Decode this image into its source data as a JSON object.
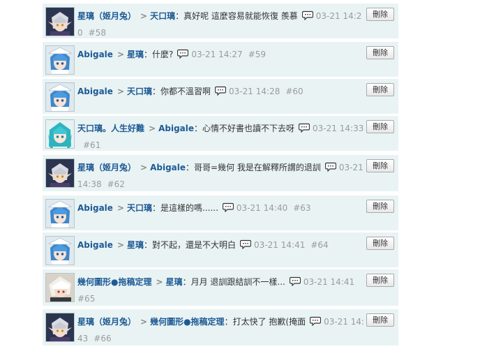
{
  "comments": [
    {
      "author": "星璃（姬月兔）",
      "target": "天口璃",
      "separator": "：",
      "text": "真好呢 這麼容易就能恢復 羨慕",
      "date": "03-21",
      "time": "14:20",
      "floor": "#58",
      "delete_label": "刪除",
      "avatar": "elf-avatar"
    },
    {
      "author": "Abigale",
      "target": "星璃",
      "separator": "：",
      "text": "什麼?",
      "date": "03-21",
      "time": "14:27",
      "floor": "#59",
      "delete_label": "刪除",
      "avatar": "blue-hair-avatar"
    },
    {
      "author": "Abigale",
      "target": "天口璃",
      "separator": "：",
      "text": "你都不溫習啊",
      "date": "03-21",
      "time": "14:28",
      "floor": "#60",
      "delete_label": "刪除",
      "avatar": "blue-hair-avatar"
    },
    {
      "author": "天口璃。人生好難",
      "target": "Abigale",
      "separator": "：",
      "text": "心情不好書也讀不下去呀",
      "date": "03-21",
      "time": "14:33",
      "floor": "#61",
      "delete_label": "刪除",
      "avatar": "teal-hair-avatar"
    },
    {
      "author": "星璃（姬月兔）",
      "target": "Abigale",
      "separator": "：",
      "text": "哥哥=幾何 我是在解釋所謂的退訓",
      "date": "03-",
      "time": "21 14:38",
      "floor": "#62",
      "delete_label": "刪除",
      "avatar": "elf-avatar"
    },
    {
      "author": "Abigale",
      "target": "天口璃",
      "separator": "：",
      "text": "是這樣的嗎......",
      "date": "03-21",
      "time": "14:40",
      "floor": "#63",
      "delete_label": "刪除",
      "avatar": "blue-hair-avatar"
    },
    {
      "author": "Abigale",
      "target": "星璃",
      "separator": "：",
      "text": "對不起，還是不大明白",
      "date": "03-21",
      "time": "14:41",
      "floor": "#64",
      "delete_label": "刪除",
      "avatar": "blue-hair-avatar"
    },
    {
      "author": "幾何圖形●拖稿定理",
      "target": "星璃",
      "separator": "：",
      "text": "月月 退訓跟結訓不一樣...",
      "date": "03-21",
      "time": "14:41",
      "floor": "#65",
      "delete_label": "刪除",
      "avatar": "white-hair-avatar"
    },
    {
      "author": "星璃（姬月兔）",
      "target": "幾何圖形●拖稿定理",
      "separator": "：",
      "text": "打太快了 抱歉(掩面",
      "date": "03-21",
      "time": "14:43",
      "floor": "#66",
      "delete_label": "刪除",
      "avatar": "elf-avatar"
    }
  ]
}
